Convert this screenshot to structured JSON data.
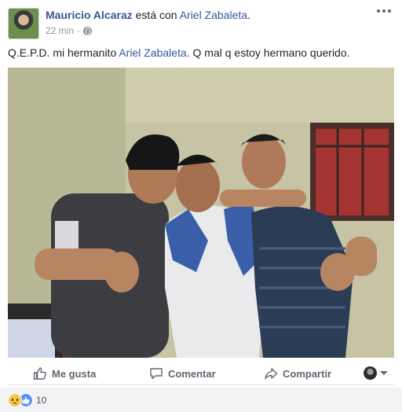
{
  "post": {
    "author": "Mauricio Alcaraz",
    "verb": " está con ",
    "tagged": "Ariel Zabaleta",
    "tagged_suffix": ".",
    "time": "22 min",
    "time_sep": "·",
    "privacy_icon": "globe-icon",
    "more_icon": "more-options-icon",
    "text_before": "Q.E.P.D. mi hermanito ",
    "text_mention": "Ariel Zabaleta",
    "text_after": ". Q mal q estoy hermano querido."
  },
  "photo": {
    "alt_icon": "photo-three-men"
  },
  "actions": {
    "like_label": "Me gusta",
    "comment_label": "Comentar",
    "share_label": "Compartir",
    "like_icon": "thumbs-up-icon",
    "comment_icon": "comment-icon",
    "share_icon": "share-icon"
  },
  "reactions": {
    "types": [
      "sad-icon",
      "like-icon"
    ],
    "count": "10"
  },
  "colors": {
    "link": "#365899",
    "secondary": "#90949c",
    "action": "#606770",
    "like_blue": "#5890ff",
    "bar_bg": "#f2f3f5"
  }
}
